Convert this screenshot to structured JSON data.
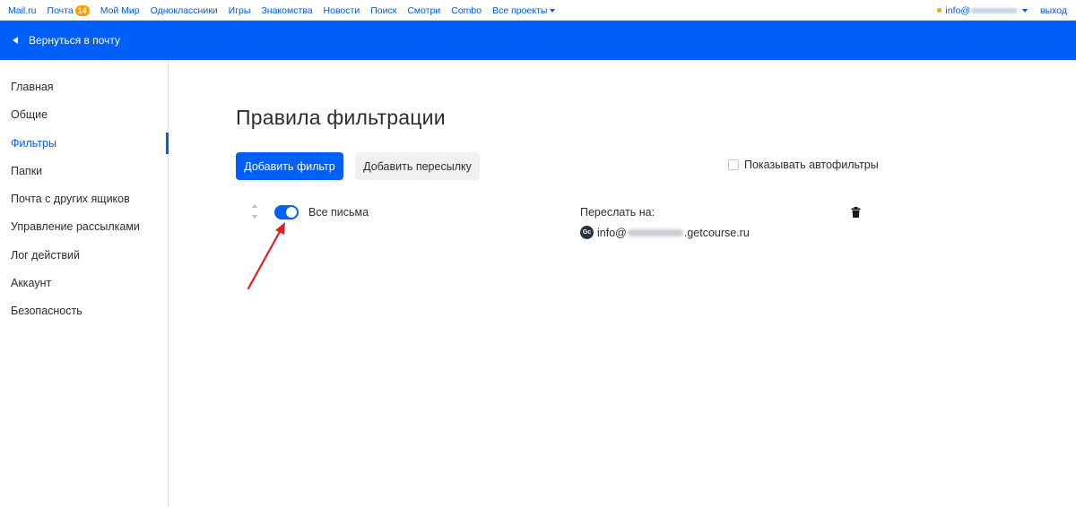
{
  "portal": {
    "links": [
      {
        "label": "Mail.ru"
      },
      {
        "label": "Почта",
        "badge": "14"
      },
      {
        "label": "Мой Мир"
      },
      {
        "label": "Одноклассники"
      },
      {
        "label": "Игры"
      },
      {
        "label": "Знакомства"
      },
      {
        "label": "Новости"
      },
      {
        "label": "Поиск"
      },
      {
        "label": "Смотри"
      },
      {
        "label": "Combo"
      },
      {
        "label": "Все проекты",
        "dropdown": true
      }
    ],
    "account_prefix": "info@",
    "logout": "выход"
  },
  "header": {
    "back_label": "Вернуться в почту"
  },
  "sidebar": {
    "items": [
      {
        "label": "Главная"
      },
      {
        "label": "Общие"
      },
      {
        "label": "Фильтры",
        "active": true
      },
      {
        "label": "Папки"
      },
      {
        "label": "Почта с других ящиков"
      },
      {
        "label": "Управление рассылками"
      },
      {
        "label": "Лог действий"
      },
      {
        "label": "Аккаунт"
      },
      {
        "label": "Безопасность"
      }
    ]
  },
  "main": {
    "title": "Правила фильтрации",
    "add_filter": "Добавить фильтр",
    "add_forward": "Добавить пересылку",
    "show_autofilters": "Показывать автофильтры",
    "filter": {
      "name": "Все письма",
      "enabled": true,
      "forward_label": "Переслать на:",
      "avatar_text": "Gc",
      "email_prefix": "info@",
      "email_suffix": ".getcourse.ru"
    }
  },
  "colors": {
    "accent": "#005ff9",
    "link": "#005bd1",
    "badge": "#ff9e00",
    "annotation": "#e02020"
  }
}
